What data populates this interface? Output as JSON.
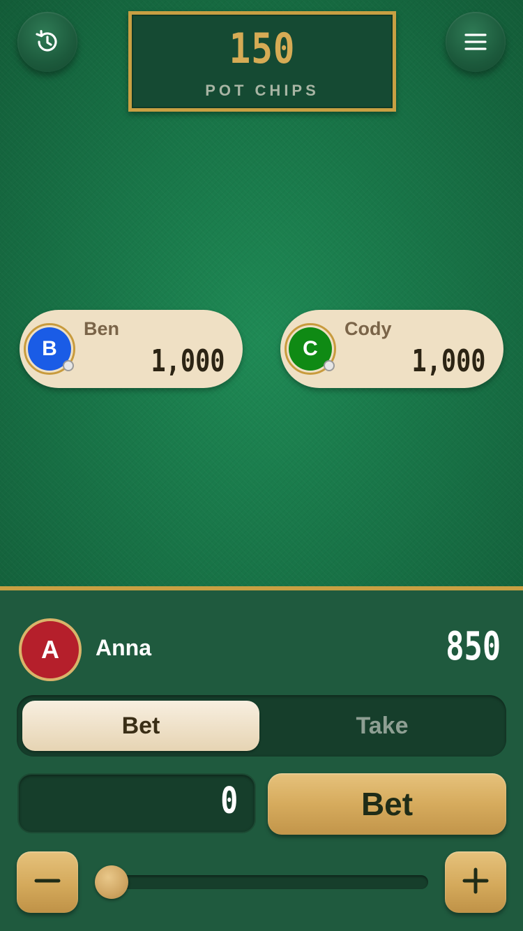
{
  "pot": {
    "amount": "150",
    "label": "POT CHIPS"
  },
  "toolbar": {
    "history_icon": "history-icon",
    "menu_icon": "menu-icon"
  },
  "opponents": [
    {
      "initial": "B",
      "name": "Ben",
      "chips": "1,000",
      "color": "#1a5ce6"
    },
    {
      "initial": "C",
      "name": "Cody",
      "chips": "1,000",
      "color": "#0f8a14"
    }
  ],
  "me": {
    "initial": "A",
    "name": "Anna",
    "chips": "850",
    "color": "#b51f2b"
  },
  "mode_tabs": {
    "bet": "Bet",
    "take": "Take",
    "selected": "Bet"
  },
  "bet": {
    "value": "0",
    "button_label": "Bet",
    "slider_fraction": 0
  },
  "colors": {
    "felt": "#1a7a4b",
    "gold": "#c8a043",
    "panel": "#1f5a3e"
  }
}
